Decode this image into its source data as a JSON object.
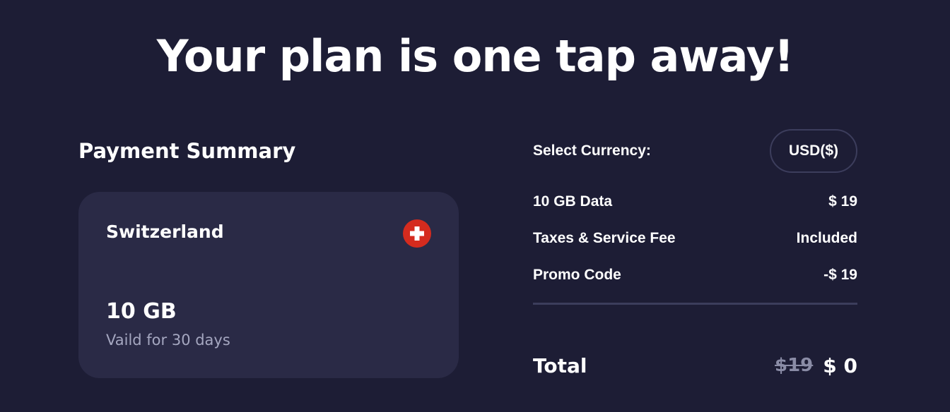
{
  "headline": "Your plan is one tap away!",
  "payment_summary": {
    "title": "Payment Summary",
    "card": {
      "country": "Switzerland",
      "flag_icon": "switzerland-flag-icon",
      "data_amount": "10 GB",
      "validity": "Vaild for 30 days"
    }
  },
  "currency": {
    "label": "Select Currency:",
    "value": "USD($)"
  },
  "line_items": [
    {
      "label": "10 GB Data",
      "value": "$ 19"
    },
    {
      "label": "Taxes & Service Fee",
      "value": "Included"
    },
    {
      "label": "Promo Code",
      "value": "-$ 19"
    }
  ],
  "total": {
    "label": "Total",
    "original_price": "$19",
    "price": "$ 0"
  },
  "colors": {
    "background": "#1d1d35",
    "card": "#2a2a46",
    "divider": "#3c3d5c",
    "muted_text": "#a5a7c0",
    "flag_red": "#d52b1e"
  }
}
